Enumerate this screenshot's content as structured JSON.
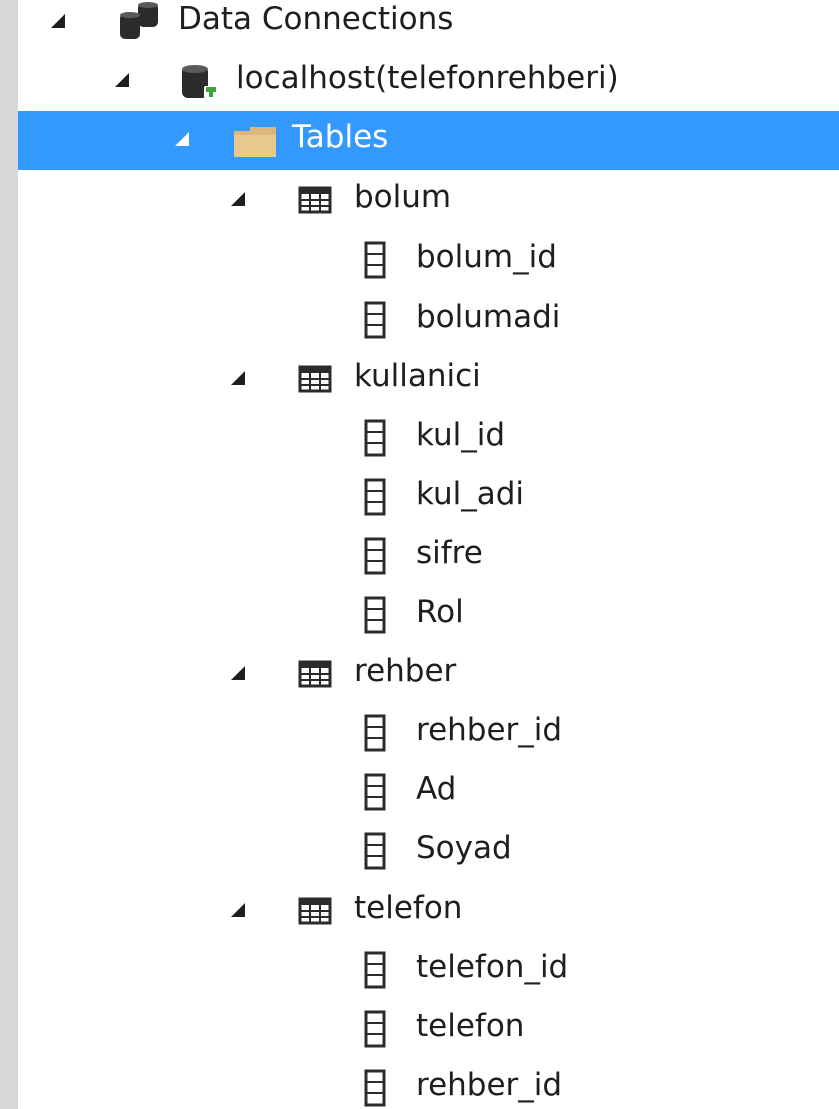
{
  "tree": {
    "root": {
      "label": "Data Connections",
      "icon": "database-connections-icon",
      "expanded": true
    },
    "connection": {
      "label": "localhost(telefonrehberi)",
      "icon": "database-connection-icon",
      "expanded": true
    },
    "tables_folder": {
      "label": "Tables",
      "icon": "folder-icon",
      "expanded": true,
      "selected": true
    },
    "tables": [
      {
        "name": "bolum",
        "icon": "table-icon",
        "expanded": true,
        "columns": [
          "bolum_id",
          "bolumadi"
        ]
      },
      {
        "name": "kullanici",
        "icon": "table-icon",
        "expanded": true,
        "columns": [
          "kul_id",
          "kul_adi",
          "sifre",
          "Rol"
        ]
      },
      {
        "name": "rehber",
        "icon": "table-icon",
        "expanded": true,
        "columns": [
          "rehber_id",
          "Ad",
          "Soyad"
        ]
      },
      {
        "name": "telefon",
        "icon": "table-icon",
        "expanded": true,
        "columns": [
          "telefon_id",
          "telefon",
          "rehber_id"
        ]
      }
    ]
  },
  "colors": {
    "selection": "#3399ff",
    "panel_background": "#ffffff",
    "frame_background": "#d8d8d8",
    "text": "#1e1e1e",
    "selected_text": "#ffffff"
  }
}
